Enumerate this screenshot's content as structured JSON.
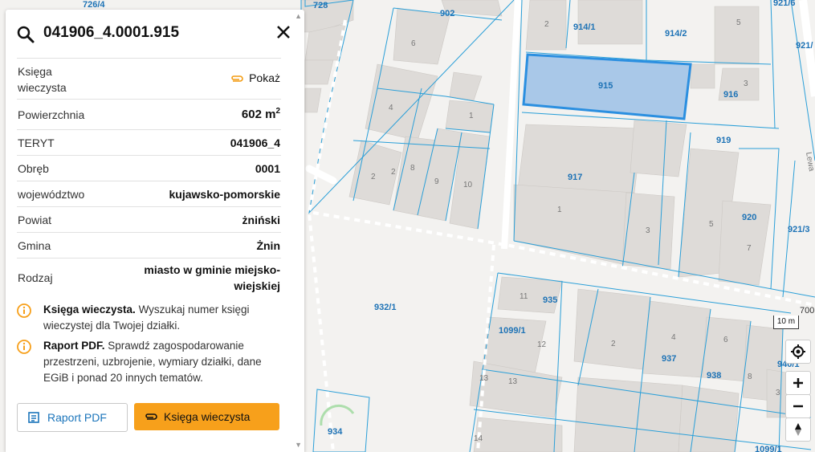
{
  "panel": {
    "title": "041906_4.0001.915",
    "rows": [
      {
        "key": "Księga\nwieczysta",
        "value": "Pokaż"
      },
      {
        "key": "Powierzchnia",
        "value": "602 m",
        "sup": "2"
      },
      {
        "key": "TERYT",
        "value": "041906_4"
      },
      {
        "key": "Obręb",
        "value": "0001"
      },
      {
        "key": "województwo",
        "value": "kujawsko-pomorskie"
      },
      {
        "key": "Powiat",
        "value": "żniński"
      },
      {
        "key": "Gmina",
        "value": "Żnin"
      },
      {
        "key": "Rodzaj",
        "value": "miasto w gminie miejsko-\nwiejskiej"
      }
    ],
    "info": [
      {
        "bold": "Księga wieczysta.",
        "text": " Wyszukaj numer księgi wieczystej dla Twojej działki."
      },
      {
        "bold": "Raport PDF.",
        "text": " Sprawdź zagospodarowanie przestrzeni, uzbrojenie, wymiary działki, dane EGiB i ponad 20 innych tematów."
      }
    ],
    "buttons": {
      "report": "Raport PDF",
      "kw": "Księga wieczysta"
    }
  },
  "map": {
    "parcels": [
      "726/4",
      "728",
      "902",
      "914/1",
      "914/2",
      "921/6",
      "921/",
      "915",
      "916",
      "919",
      "917",
      "920",
      "921/3",
      "932/1",
      "935",
      "1099/1",
      "937",
      "938",
      "940/1",
      "934",
      "700",
      "1099/1"
    ],
    "buildings": [
      "6",
      "5",
      "3",
      "2",
      "4",
      "1",
      "2",
      "2",
      "8",
      "9",
      "10",
      "1",
      "3",
      "5",
      "7",
      "11",
      "12",
      "2",
      "4",
      "6",
      "8",
      "13",
      "13",
      "14",
      "3"
    ],
    "street": "Lewa",
    "scale": "10 m"
  },
  "colors": {
    "parcel_line": "#2a9fd8",
    "selected_fill": "#a9c8e8",
    "selected_stroke": "#2b8fe0",
    "orange": "#f7a01b",
    "link": "#1b75bb"
  }
}
